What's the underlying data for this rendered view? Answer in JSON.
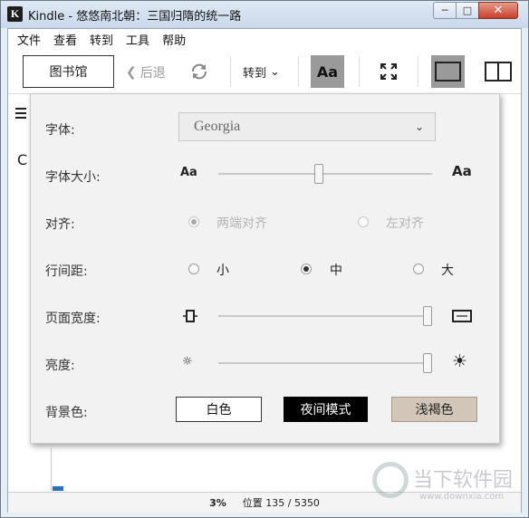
{
  "window": {
    "title": "Kindle - 悠悠南北朝：三国归隋的统一路",
    "app_icon_letter": "K",
    "minimize_icon": "minimize-icon",
    "maximize_icon": "maximize-icon",
    "close_icon": "close-icon"
  },
  "menu": {
    "items": [
      "文件",
      "查看",
      "转到",
      "工具",
      "帮助"
    ]
  },
  "toolbar": {
    "library_label": "图书馆",
    "back_label": "后退",
    "goto_label": "转到",
    "aa_label": "Aa"
  },
  "reader": {
    "partial_letter": "C"
  },
  "settings": {
    "font_label": "字体:",
    "font_value": "Georgia",
    "font_size_label": "字体大小:",
    "font_size_level": 0.47,
    "align_label": "对齐:",
    "align_options": [
      {
        "label": "两端对齐",
        "checked": true,
        "disabled": true
      },
      {
        "label": "左对齐",
        "checked": false,
        "disabled": true
      }
    ],
    "line_spacing_label": "行间距:",
    "line_spacing_options": [
      {
        "label": "小",
        "checked": false
      },
      {
        "label": "中",
        "checked": true
      },
      {
        "label": "大",
        "checked": false
      }
    ],
    "page_width_label": "页面宽度:",
    "page_width_level": 1.0,
    "brightness_label": "亮度:",
    "brightness_level": 1.0,
    "background_label": "背景色:",
    "background_options": [
      {
        "label": "白色",
        "color": "#ffffff"
      },
      {
        "label": "夜间模式",
        "color": "#000000"
      },
      {
        "label": "浅褐色",
        "color": "#d2c6b8"
      }
    ]
  },
  "status": {
    "percent": "3%",
    "location": "位置 135 / 5350"
  },
  "watermark": {
    "text": "当下软件园",
    "url": "www.downxia.com"
  }
}
